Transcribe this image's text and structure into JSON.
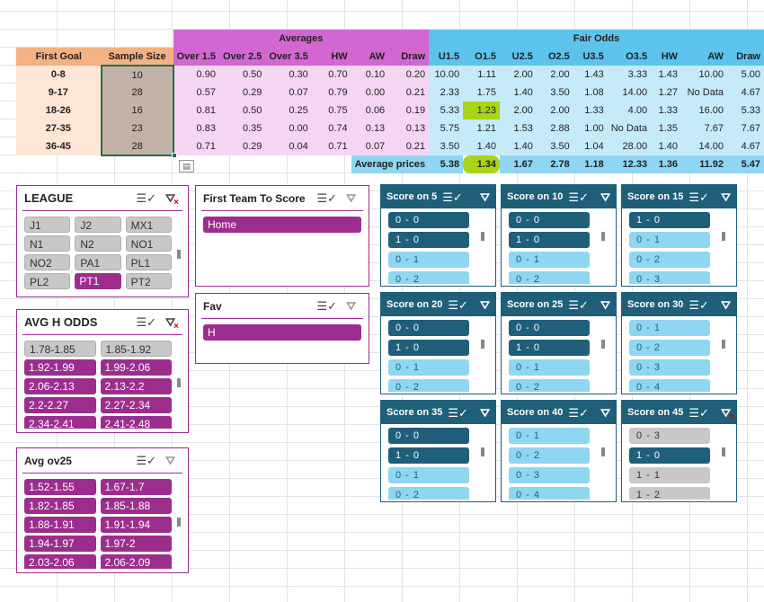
{
  "table": {
    "group_averages": "Averages",
    "group_fair_odds": "Fair Odds",
    "headers": [
      "First Goal",
      "Sample Size",
      "Over 1.5",
      "Over 2.5",
      "Over 3.5",
      "HW",
      "AW",
      "Draw",
      "U1.5",
      "O1.5",
      "U2.5",
      "O2.5",
      "U3.5",
      "O3.5",
      "HW",
      "AW",
      "Draw"
    ],
    "rows": [
      [
        "0-8",
        "10",
        "0.90",
        "0.50",
        "0.30",
        "0.70",
        "0.10",
        "0.20",
        "10.00",
        "1.11",
        "2.00",
        "2.00",
        "1.43",
        "3.33",
        "1.43",
        "10.00",
        "5.00"
      ],
      [
        "9-17",
        "28",
        "0.57",
        "0.29",
        "0.07",
        "0.79",
        "0.00",
        "0.21",
        "2.33",
        "1.75",
        "1.40",
        "3.50",
        "1.08",
        "14.00",
        "1.27",
        "No Data",
        "4.67"
      ],
      [
        "18-26",
        "16",
        "0.81",
        "0.50",
        "0.25",
        "0.75",
        "0.06",
        "0.19",
        "5.33",
        "1.23",
        "2.00",
        "2.00",
        "1.33",
        "4.00",
        "1.33",
        "16.00",
        "5.33"
      ],
      [
        "27-35",
        "23",
        "0.83",
        "0.35",
        "0.00",
        "0.74",
        "0.13",
        "0.13",
        "5.75",
        "1.21",
        "1.53",
        "2.88",
        "1.00",
        "No Data",
        "1.35",
        "7.67",
        "7.67"
      ],
      [
        "36-45",
        "28",
        "0.71",
        "0.29",
        "0.04",
        "0.71",
        "0.07",
        "0.21",
        "3.50",
        "1.40",
        "1.40",
        "3.50",
        "1.04",
        "28.00",
        "1.40",
        "14.00",
        "4.67"
      ]
    ],
    "avg_label": "Average prices",
    "avg_values": [
      "5.38",
      "1.34",
      "1.67",
      "2.78",
      "1.18",
      "12.33",
      "1.36",
      "11.92",
      "5.47"
    ]
  },
  "slicers": {
    "league": {
      "title": "LEAGUE",
      "items": [
        {
          "label": "J1",
          "sel": false
        },
        {
          "label": "J2",
          "sel": false
        },
        {
          "label": "MX1",
          "sel": false
        },
        {
          "label": "N1",
          "sel": false
        },
        {
          "label": "N2",
          "sel": false
        },
        {
          "label": "NO1",
          "sel": false
        },
        {
          "label": "NO2",
          "sel": false
        },
        {
          "label": "PA1",
          "sel": false
        },
        {
          "label": "PL1",
          "sel": false
        },
        {
          "label": "PL2",
          "sel": false
        },
        {
          "label": "PT1",
          "sel": true
        },
        {
          "label": "PT2",
          "sel": false
        }
      ]
    },
    "avg_h_odds": {
      "title": "AVG H ODDS",
      "items": [
        {
          "label": "1.78-1.85",
          "sel": false
        },
        {
          "label": "1.85-1.92",
          "sel": false
        },
        {
          "label": "1.92-1.99",
          "sel": true
        },
        {
          "label": "1.99-2.06",
          "sel": true
        },
        {
          "label": "2.06-2.13",
          "sel": true
        },
        {
          "label": "2.13-2.2",
          "sel": true
        },
        {
          "label": "2.2-2.27",
          "sel": true
        },
        {
          "label": "2.27-2.34",
          "sel": true
        },
        {
          "label": "2.34-2.41",
          "sel": true
        },
        {
          "label": "2.41-2.48",
          "sel": true
        }
      ]
    },
    "avg_ov25": {
      "title": "Avg ov25",
      "items": [
        {
          "label": "1.52-1.55",
          "sel": true
        },
        {
          "label": "1.67-1.7",
          "sel": true
        },
        {
          "label": "1.82-1.85",
          "sel": true
        },
        {
          "label": "1.85-1.88",
          "sel": true
        },
        {
          "label": "1.88-1.91",
          "sel": true
        },
        {
          "label": "1.91-1.94",
          "sel": true
        },
        {
          "label": "1.94-1.97",
          "sel": true
        },
        {
          "label": "1.97-2",
          "sel": true
        },
        {
          "label": "2.03-2.06",
          "sel": true
        },
        {
          "label": "2.06-2.09",
          "sel": true
        }
      ]
    },
    "first_team": {
      "title": "First Team To Score",
      "items": [
        {
          "label": "Home",
          "sel": true
        }
      ]
    },
    "fav": {
      "title": "Fav",
      "items": [
        {
          "label": "H",
          "sel": true
        }
      ]
    }
  },
  "scores": [
    {
      "title": "Score on 5",
      "items": [
        [
          "0 - 0",
          "d"
        ],
        [
          "1 - 0",
          "d"
        ],
        [
          "0 - 1",
          "l"
        ],
        [
          "0 - 2",
          "l"
        ]
      ]
    },
    {
      "title": "Score on 10",
      "items": [
        [
          "0 - 0",
          "d"
        ],
        [
          "1 - 0",
          "d"
        ],
        [
          "0 - 1",
          "l"
        ],
        [
          "0 - 2",
          "l"
        ]
      ]
    },
    {
      "title": "Score on 15",
      "items": [
        [
          "1 - 0",
          "d"
        ],
        [
          "0 - 1",
          "l"
        ],
        [
          "0 - 2",
          "l"
        ],
        [
          "0 - 3",
          "l"
        ]
      ]
    },
    {
      "title": "Score on 20",
      "items": [
        [
          "0 - 0",
          "d"
        ],
        [
          "1 - 0",
          "d"
        ],
        [
          "0 - 1",
          "l"
        ],
        [
          "0 - 2",
          "l"
        ]
      ]
    },
    {
      "title": "Score on 25",
      "items": [
        [
          "0 - 0",
          "d"
        ],
        [
          "1 - 0",
          "d"
        ],
        [
          "0 - 1",
          "l"
        ],
        [
          "0 - 2",
          "l"
        ]
      ]
    },
    {
      "title": "Score on 30",
      "items": [
        [
          "0 - 1",
          "l"
        ],
        [
          "0 - 2",
          "l"
        ],
        [
          "0 - 3",
          "l"
        ],
        [
          "0 - 4",
          "l"
        ]
      ]
    },
    {
      "title": "Score on 35",
      "items": [
        [
          "0 - 0",
          "d"
        ],
        [
          "1 - 0",
          "d"
        ],
        [
          "0 - 1",
          "l"
        ],
        [
          "0 - 2",
          "l"
        ]
      ]
    },
    {
      "title": "Score on 40",
      "items": [
        [
          "0 - 1",
          "l"
        ],
        [
          "0 - 2",
          "l"
        ],
        [
          "0 - 3",
          "l"
        ],
        [
          "0 - 4",
          "l"
        ]
      ]
    },
    {
      "title": "Score on 45",
      "items": [
        [
          "0 - 3",
          "g"
        ],
        [
          "1 - 0",
          "d"
        ],
        [
          "1 - 1",
          "g"
        ],
        [
          "1 - 2",
          "g"
        ]
      ]
    }
  ]
}
